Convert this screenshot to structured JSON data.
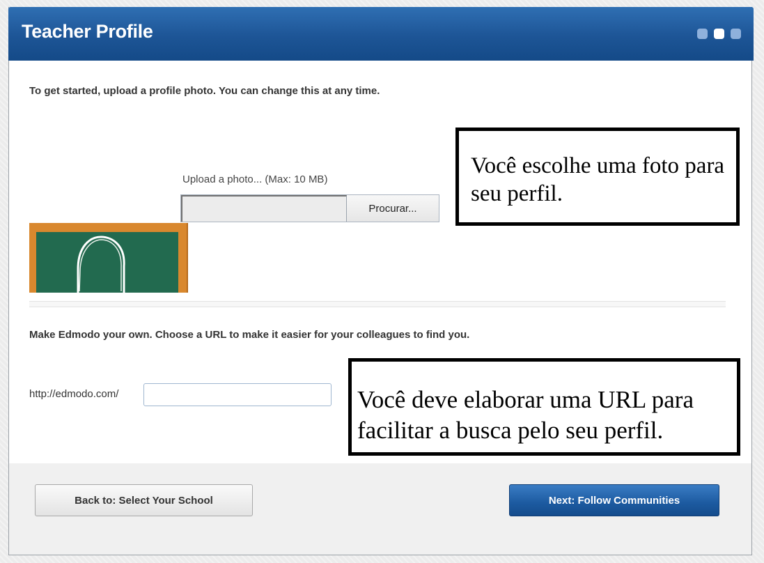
{
  "header": {
    "title": "Teacher Profile",
    "steps": [
      {
        "active": false
      },
      {
        "active": true
      },
      {
        "active": false
      }
    ]
  },
  "photo": {
    "intro": "To get started, upload a profile photo. You can change this at any time.",
    "upload_label": "Upload a photo... (Max: 10 MB)",
    "browse_button": "Procurar...",
    "file_value": ""
  },
  "annotations": {
    "photo_note": "Você escolhe uma foto para seu perfil.",
    "url_note": "Você deve elaborar uma URL para facilitar a busca pelo seu perfil."
  },
  "url": {
    "description": "Make Edmodo your own. Choose a URL to make it easier for your colleagues to find you.",
    "prefix": "http://edmodo.com/",
    "value": "",
    "placeholder": ""
  },
  "footer": {
    "back_button": "Back to: Select Your School",
    "next_button": "Next: Follow Communities"
  },
  "colors": {
    "header": "#1d5596",
    "chalkboard_frame": "#d9882e",
    "chalkboard": "#226a4f",
    "next_button": "#1c5aa0"
  }
}
